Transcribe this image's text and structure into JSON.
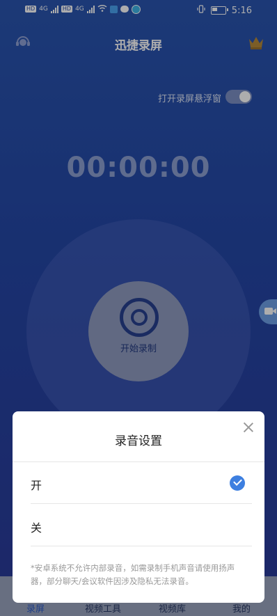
{
  "status_bar": {
    "chips": [
      "HD",
      "HD"
    ],
    "network": "4G",
    "network2": "4G",
    "time": "5:16"
  },
  "header": {
    "title": "迅捷录屏"
  },
  "floating_window": {
    "label": "打开录屏悬浮窗",
    "enabled": false
  },
  "timer": "00:00:00",
  "record_button": {
    "label": "开始录制"
  },
  "bottom_nav": {
    "items": [
      {
        "label": "录屏",
        "active": true
      },
      {
        "label": "视频工具",
        "active": false
      },
      {
        "label": "视频库",
        "active": false
      },
      {
        "label": "我的",
        "active": false
      }
    ]
  },
  "dialog": {
    "title": "录音设置",
    "options": [
      {
        "label": "开",
        "selected": true
      },
      {
        "label": "关",
        "selected": false
      }
    ],
    "note": "*安卓系统不允许内部录音，如需录制手机声音请使用扬声器，部分聊天/会议软件因涉及隐私无法录音。"
  },
  "colors": {
    "accent": "#3d7fe0",
    "background": "#2447a6"
  }
}
